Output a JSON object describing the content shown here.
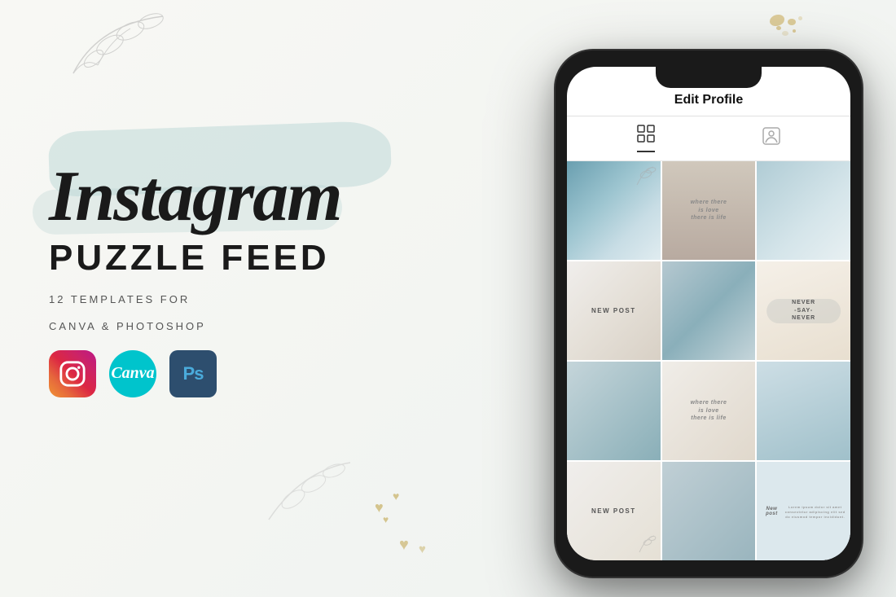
{
  "background": {
    "color": "#f5f5f0"
  },
  "left": {
    "title": "Instagram",
    "subtitle": "PUZZLE FEED",
    "templates_line1": "12  TEMPLATES  FOR",
    "templates_line2": "CANVA & PHOTOSHOP",
    "icons": [
      {
        "name": "instagram",
        "label": "Instagram"
      },
      {
        "name": "canva",
        "label": "Canva"
      },
      {
        "name": "photoshop",
        "label": "Ps"
      }
    ]
  },
  "phone": {
    "header_title": "Edit Profile",
    "tabs": [
      {
        "name": "grid-tab",
        "active": true
      },
      {
        "name": "profile-tab",
        "active": false
      }
    ],
    "grid": [
      {
        "id": 1,
        "type": "image",
        "text": "",
        "style": "cell-1"
      },
      {
        "id": 2,
        "type": "text",
        "text": "where there\nis love\nthere is life",
        "style": "cell-2"
      },
      {
        "id": 3,
        "type": "image",
        "text": "",
        "style": "cell-3"
      },
      {
        "id": 4,
        "type": "text",
        "text": "NEW POST",
        "style": "cell-4"
      },
      {
        "id": 5,
        "type": "image",
        "text": "",
        "style": "cell-5"
      },
      {
        "id": 6,
        "type": "text",
        "text": "NEVER\n-SAY-\nNEVER",
        "style": "cell-6"
      },
      {
        "id": 7,
        "type": "image",
        "text": "",
        "style": "cell-7"
      },
      {
        "id": 8,
        "type": "text",
        "text": "where there\nis love\nthere is life",
        "style": "cell-8"
      },
      {
        "id": 9,
        "type": "image",
        "text": "",
        "style": "cell-9"
      },
      {
        "id": 10,
        "type": "text",
        "text": "NEW POST",
        "style": "cell-4"
      },
      {
        "id": 11,
        "type": "image",
        "text": "",
        "style": "cell-1"
      },
      {
        "id": 12,
        "type": "text",
        "text": "New post",
        "style": "cell-9"
      }
    ]
  }
}
